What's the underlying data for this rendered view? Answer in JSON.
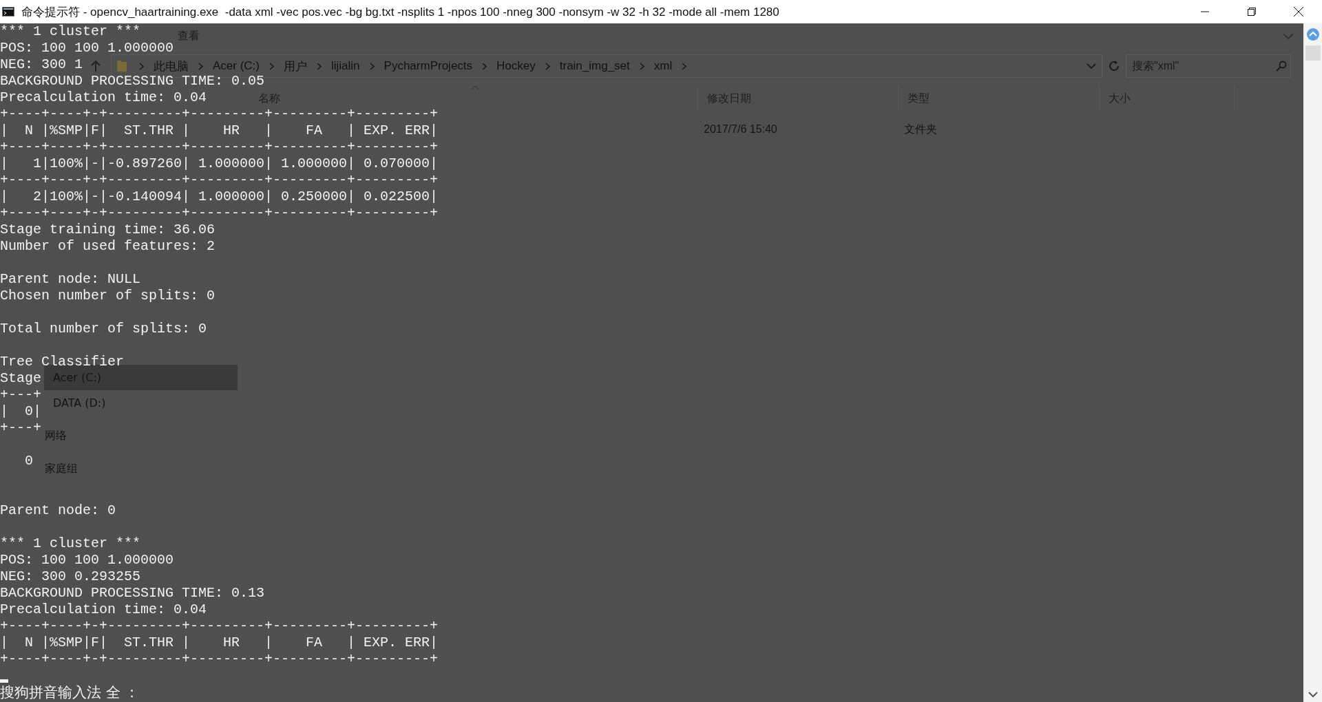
{
  "title_bar": {
    "title": "命令提示符 - opencv_haartraining.exe  -data xml -vec pos.vec -bg bg.txt -nsplits 1 -npos 100 -nneg 300 -nonsym -w 32 -h 32 -mode all -mem 1280"
  },
  "explorer": {
    "ribbon_tabs": [
      {
        "label": "查看"
      }
    ],
    "breadcrumb": [
      "此电脑",
      "Acer (C:)",
      "用户",
      "lijialin",
      "PycharmProjects",
      "Hockey",
      "train_img_set",
      "xml"
    ],
    "search": {
      "placeholder": "搜索\"xml\""
    },
    "columns": [
      {
        "label": "名称"
      },
      {
        "label": "修改日期"
      },
      {
        "label": "类型"
      },
      {
        "label": "大小"
      }
    ],
    "rows": [
      {
        "modified": "2017/7/6 15:40",
        "type": "文件夹"
      }
    ],
    "sidebar": [
      {
        "items": [
          {
            "label": "Acer (C:)",
            "selected": true
          },
          {
            "label": "DATA (D:)",
            "selected": false
          }
        ]
      },
      {
        "items": [
          {
            "label": "网络",
            "selected": false
          }
        ]
      },
      {
        "items": [
          {
            "label": "家庭组",
            "selected": false
          }
        ]
      }
    ]
  },
  "console": {
    "lines": [
      {
        "kind": "text",
        "text": "*** 1 cluster ***"
      },
      {
        "kind": "text",
        "text": "POS: 100 100 1.000000"
      },
      {
        "kind": "text",
        "text": "NEG: 300 1"
      },
      {
        "kind": "text",
        "text": "BACKGROUND PROCESSING TIME: 0.05"
      },
      {
        "kind": "text",
        "text": "Precalculation time: 0.04"
      },
      {
        "kind": "text",
        "text": "+----+----+-+---------+---------+---------+---------+"
      },
      {
        "kind": "text",
        "text": "|  N |%SMP|F|  ST.THR |    HR   |    FA   | EXP. ERR|"
      },
      {
        "kind": "text",
        "text": "+----+----+-+---------+---------+---------+---------+"
      },
      {
        "kind": "text",
        "text": "|   1|100%|-|-0.897260| 1.000000| 1.000000| 0.070000|"
      },
      {
        "kind": "text",
        "text": "+----+----+-+---------+---------+---------+---------+"
      },
      {
        "kind": "text",
        "text": "|   2|100%|-|-0.140094| 1.000000| 0.250000| 0.022500|"
      },
      {
        "kind": "text",
        "text": "+----+----+-+---------+---------+---------+---------+"
      },
      {
        "kind": "text",
        "text": "Stage training time: 36.06"
      },
      {
        "kind": "text",
        "text": "Number of used features: 2"
      },
      {
        "kind": "blank"
      },
      {
        "kind": "text",
        "text": "Parent node: NULL"
      },
      {
        "kind": "text",
        "text": "Chosen number of splits: 0"
      },
      {
        "kind": "blank"
      },
      {
        "kind": "text",
        "text": "Total number of splits: 0"
      },
      {
        "kind": "blank"
      },
      {
        "kind": "text",
        "text": "Tree Classifier"
      },
      {
        "kind": "text",
        "text": "Stage"
      },
      {
        "kind": "text",
        "text": "+---+"
      },
      {
        "kind": "text",
        "text": "|  0|"
      },
      {
        "kind": "text",
        "text": "+---+"
      },
      {
        "kind": "blank"
      },
      {
        "kind": "text",
        "text": "   0"
      },
      {
        "kind": "blank"
      },
      {
        "kind": "blank"
      },
      {
        "kind": "text",
        "text": "Parent node: 0"
      },
      {
        "kind": "blank"
      },
      {
        "kind": "text",
        "text": "*** 1 cluster ***"
      },
      {
        "kind": "text",
        "text": "POS: 100 100 1.000000"
      },
      {
        "kind": "text",
        "text": "NEG: 300 0.293255"
      },
      {
        "kind": "text",
        "text": "BACKGROUND PROCESSING TIME: 0.13"
      },
      {
        "kind": "text",
        "text": "Precalculation time: 0.04"
      },
      {
        "kind": "text",
        "text": "+----+----+-+---------+---------+---------+---------+"
      },
      {
        "kind": "text",
        "text": "|  N |%SMP|F|  ST.THR |    HR   |    FA   | EXP. ERR|"
      },
      {
        "kind": "text",
        "text": "+----+----+-+---------+---------+---------+---------+"
      },
      {
        "kind": "cursor"
      },
      {
        "kind": "ime",
        "text": "搜狗拼音输入法 全 ："
      }
    ]
  }
}
